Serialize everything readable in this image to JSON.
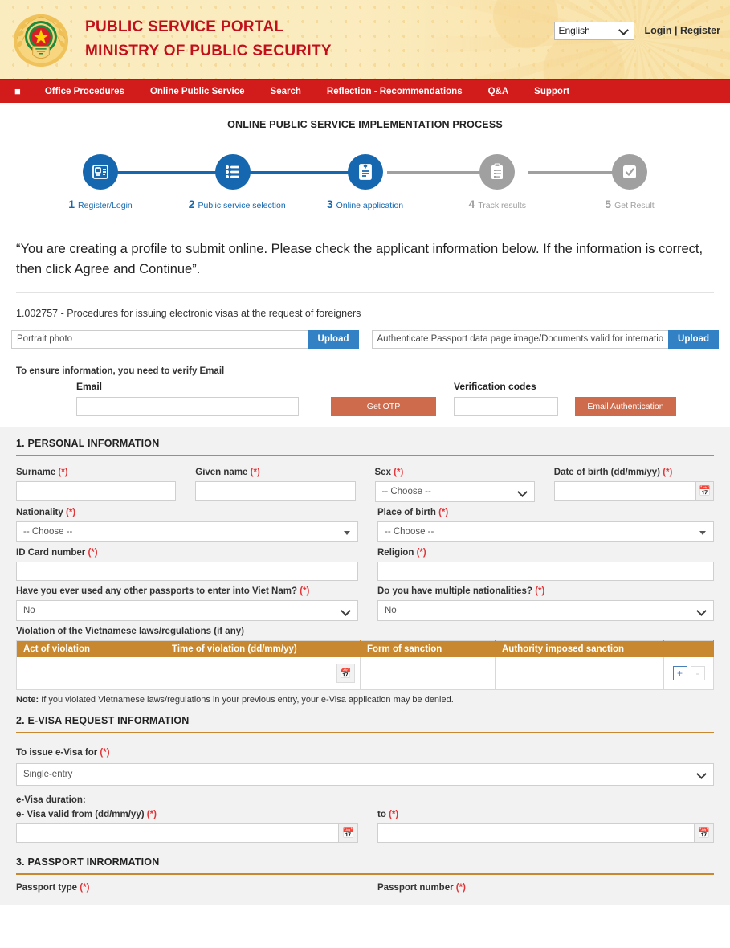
{
  "header": {
    "logo_alt": "ministry-of-public-security-emblem",
    "title_line1": "PUBLIC SERVICE PORTAL",
    "title_line2": "MINISTRY OF PUBLIC SECURITY",
    "language_selected": "English",
    "language_options": [
      "English"
    ],
    "login_label": "Login",
    "separator": "|",
    "register_label": "Register"
  },
  "nav": {
    "home_icon": "home-icon",
    "items": [
      "Office Procedures",
      "Online Public Service",
      "Search",
      "Reflection - Recommendations",
      "Q&A",
      "Support"
    ]
  },
  "stepper": {
    "title": "ONLINE PUBLIC SERVICE IMPLEMENTATION PROCESS",
    "active_color": "#1568b0",
    "inactive_color": "#a0a0a0",
    "steps": [
      {
        "num": "1",
        "label": "Register/Login",
        "icon": "id-card-icon",
        "state": "active"
      },
      {
        "num": "2",
        "label": "Public service selection",
        "icon": "list-icon",
        "state": "active"
      },
      {
        "num": "3",
        "label": "Online application",
        "icon": "upload-doc-icon",
        "state": "active"
      },
      {
        "num": "4",
        "label": "Track results",
        "icon": "clipboard-icon",
        "state": "inactive"
      },
      {
        "num": "5",
        "label": "Get Result",
        "icon": "check-square-icon",
        "state": "inactive"
      }
    ]
  },
  "notice": "“You are creating a profile to submit online. Please check the applicant information below. If the information is correct, then click Agree and Continue”.",
  "procedure": "1.002757 - Procedures for issuing electronic visas at the request of foreigners",
  "uploads": [
    {
      "placeholder": "Portrait photo",
      "button": "Upload"
    },
    {
      "placeholder": "Authenticate Passport data page image/Documents valid for international",
      "button": "Upload"
    }
  ],
  "email_verify": {
    "note": "To ensure information, you need to verify Email",
    "email_label": "Email",
    "email_value": "",
    "get_otp_label": "Get OTP",
    "codes_label": "Verification codes",
    "codes_value": "",
    "authenticate_label": "Email Authentication",
    "button_color": "#cd6b4c"
  },
  "section1": {
    "heading": "1. PERSONAL INFORMATION",
    "rule_color": "#c8882f",
    "surname_label": "Surname",
    "given_name_label": "Given name",
    "sex_label": "Sex",
    "sex_value": "-- Choose --",
    "dob_label": "Date of birth (dd/mm/yy)",
    "nationality_label": "Nationality",
    "nationality_value": "-- Choose --",
    "pob_label": "Place of birth",
    "pob_value": "-- Choose --",
    "id_card_label": "ID Card number",
    "religion_label": "Religion",
    "other_passports_label": "Have you ever used any other passports to enter into Viet Nam?",
    "other_passports_value": "No",
    "multi_nat_label": "Do you have multiple nationalities?",
    "multi_nat_value": "No",
    "required_marker": "(*)",
    "violation": {
      "label": "Violation of the Vietnamese laws/regulations (if any)",
      "columns": [
        "Act of violation",
        "Time of violation (dd/mm/yy)",
        "Form of sanction",
        "Authority imposed sanction"
      ],
      "rows": [
        {
          "act": "",
          "time": "",
          "form": "",
          "authority": ""
        }
      ],
      "add_label": "+",
      "remove_label": "-",
      "header_color": "#c8882f"
    },
    "note_prefix": "Note:",
    "note_text": " If you violated Vietnamese laws/regulations in your previous entry, your e-Visa application may be denied."
  },
  "section2": {
    "heading": "2. E-VISA REQUEST INFORMATION",
    "issue_for_label": "To issue e-Visa for",
    "issue_for_value": "Single-entry",
    "duration_label": "e-Visa duration:",
    "valid_from_label": "e- Visa valid from (dd/mm/yy)",
    "valid_from_value": "",
    "to_label": "to",
    "to_value": ""
  },
  "section3": {
    "heading": "3. PASSPORT INRORMATION",
    "passport_type_label": "Passport type",
    "passport_number_label": "Passport number"
  },
  "icons": {
    "calendar": "calendar-icon",
    "chevron_down": "chevron-down-icon"
  }
}
